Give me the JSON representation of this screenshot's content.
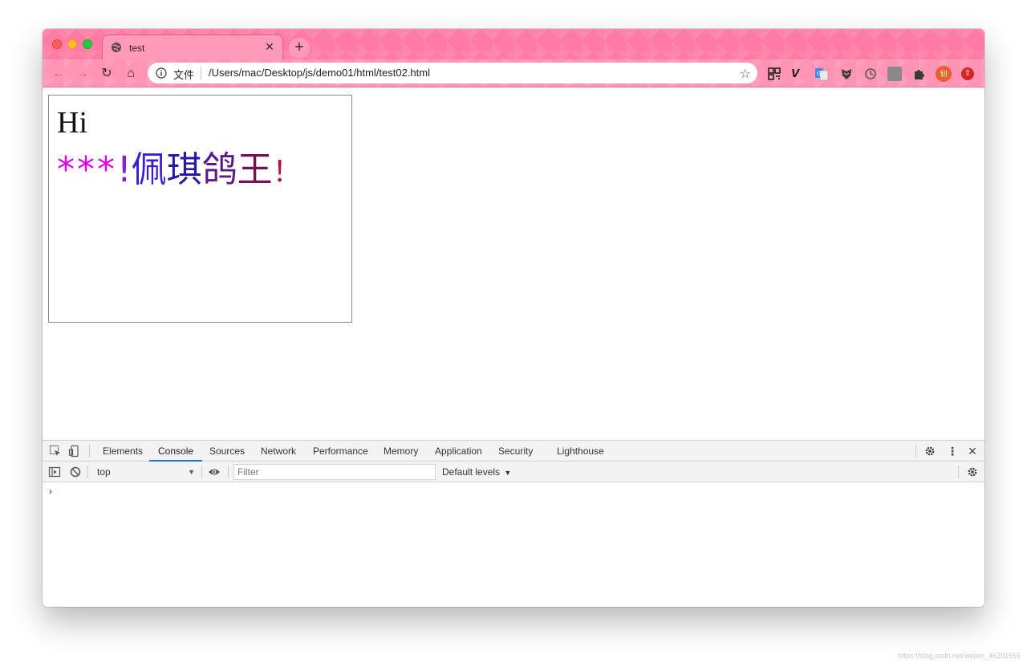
{
  "browser": {
    "tab": {
      "title": "test"
    },
    "address_bar": {
      "scheme_label": "文件",
      "url": "/Users/mac/Desktop/js/demo01/html/test02.html"
    },
    "accent_color": "#ff7aa4",
    "extension_icons": [
      "qr-code-icon",
      "vd-extension-icon",
      "translate-icon",
      "fox-extension-icon",
      "history-icon",
      "gray-square-icon",
      "puzzle-icon",
      "avatar-icon",
      "update-icon"
    ]
  },
  "page": {
    "heading": "Hi",
    "message": {
      "stars": "***",
      "exclaim": "!",
      "chars": [
        "佩",
        "琪",
        "鸽",
        "王"
      ],
      "end": "！"
    }
  },
  "devtools": {
    "tabs": [
      "Elements",
      "Console",
      "Sources",
      "Network",
      "Performance",
      "Memory",
      "Application",
      "Security",
      "Lighthouse"
    ],
    "active_tab": "Console",
    "context": "top",
    "filter_placeholder": "Filter",
    "levels": "Default levels",
    "prompt": "›"
  },
  "watermark": "https://blog.csdn.net/weixin_46291555"
}
